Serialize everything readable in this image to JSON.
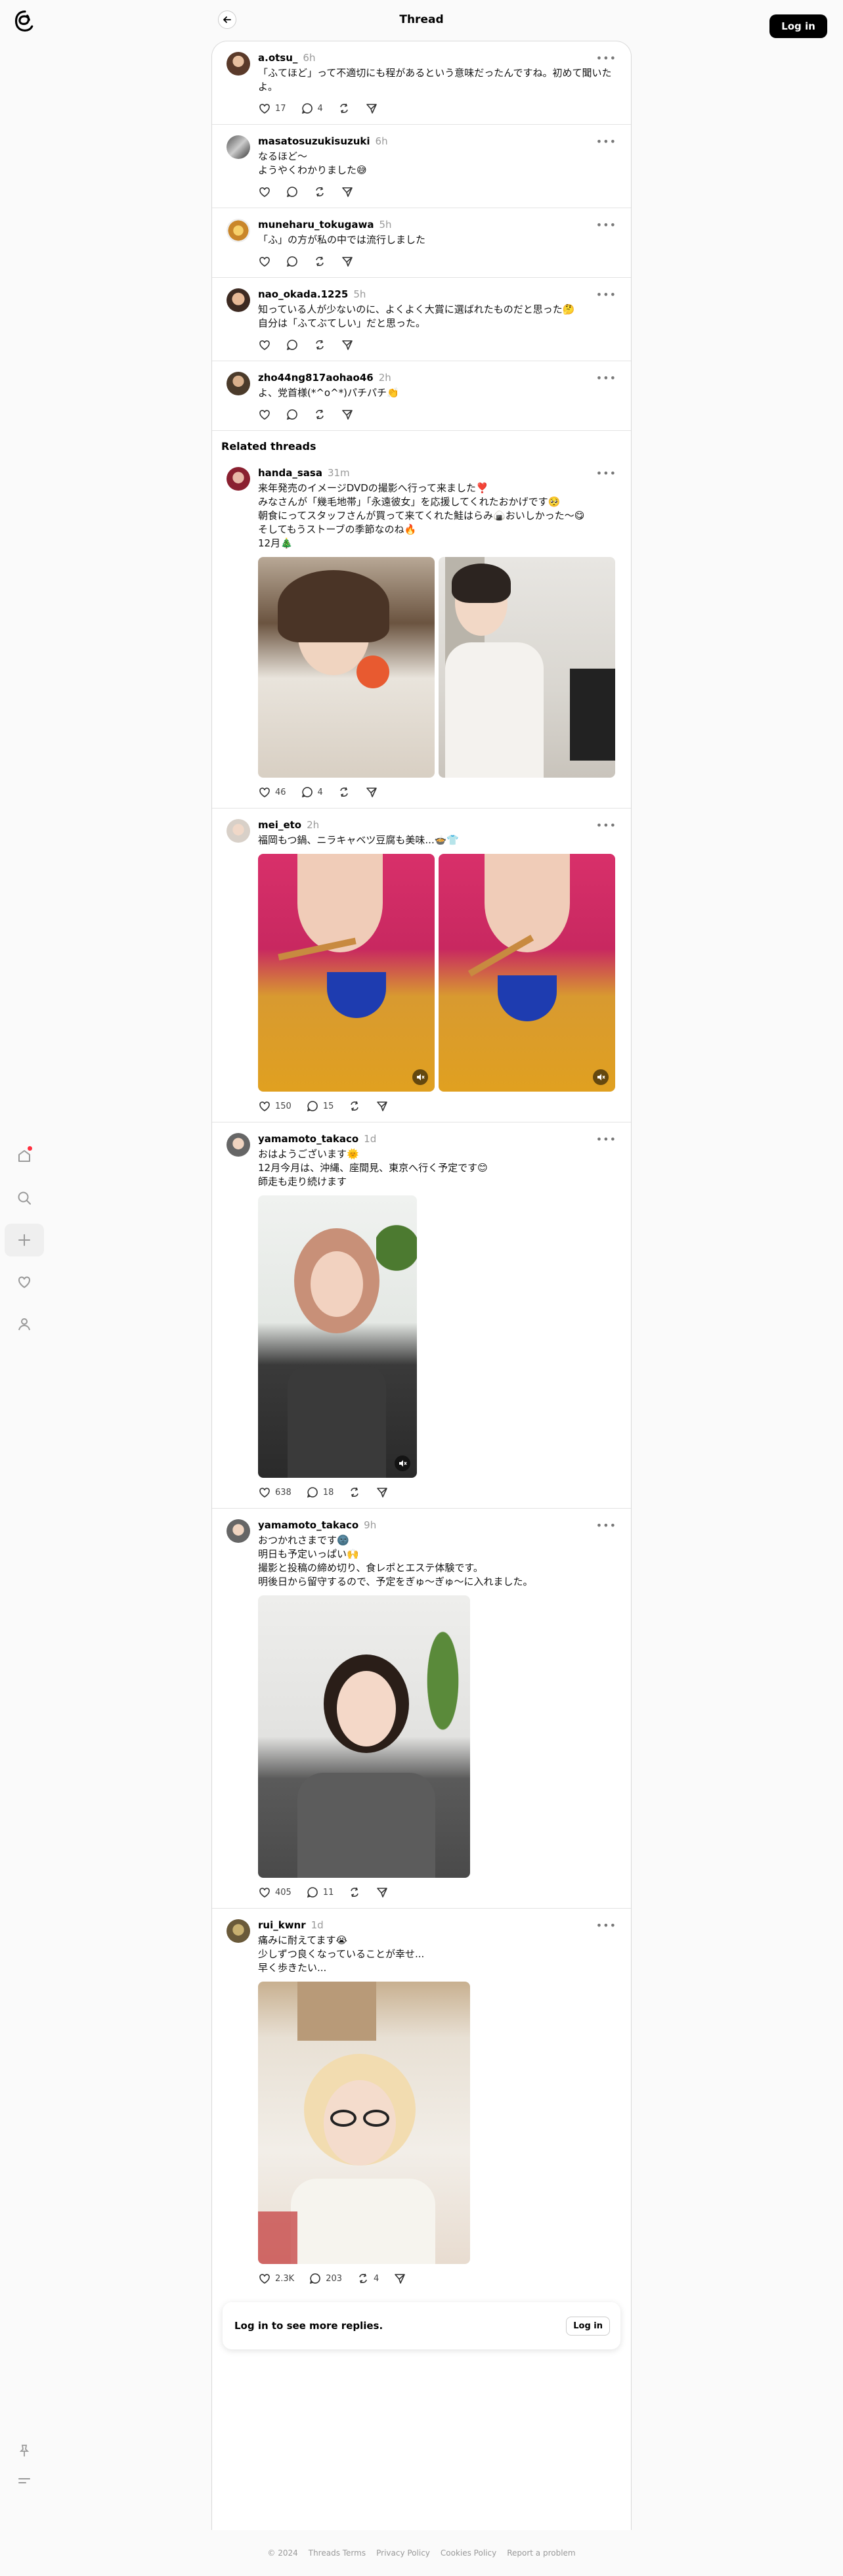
{
  "header": {
    "title": "Thread",
    "login_label": "Log in"
  },
  "root_post": {
    "username": "a.otsu_",
    "time": "6h",
    "text": "「ふてほど」って不適切にも程があるという意味だったんですね。初めて聞いたよ。",
    "likes": "17",
    "replies": "4"
  },
  "replies": [
    {
      "username": "masatosuzukisuzuki",
      "time": "6h",
      "text": "なるほど〜\nようやくわかりました😅"
    },
    {
      "username": "muneharu_tokugawa",
      "time": "5h",
      "text": "「ふ」の方が私の中では流行しました"
    },
    {
      "username": "nao_okada.1225",
      "time": "5h",
      "text": "知っている人が少ないのに、よくよく大賞に選ばれたものだと思った🤔\n自分は「ふてぶてしい」だと思った。"
    },
    {
      "username": "zho44ng817aohao46",
      "time": "2h",
      "text": "よ、党首様(*^o^*)パチパチ👏"
    }
  ],
  "related_title": "Related threads",
  "related": [
    {
      "username": "handa_sasa",
      "time": "31m",
      "text": "来年発売のイメージDVDの撮影へ行って来ました❣️\nみなさんが「幾毛地帯」「永遠彼女」を応援してくれたおかげです🥺\n朝食にってスタッフさんが買って来てくれた鮭はらみ🍙おいしかった〜😋\nそしてもうストーブの季節なのね🔥\n12月🎄",
      "likes": "46",
      "replies": "4",
      "reposts": ""
    },
    {
      "username": "mei_eto",
      "time": "2h",
      "text": "福岡もつ鍋、ニラキャベツ豆腐も美味...🍲👕",
      "likes": "150",
      "replies": "15",
      "reposts": ""
    },
    {
      "username": "yamamoto_takaco",
      "time": "1d",
      "text": "おはようございます🌞\n12月今月は、沖縄、座間見、東京へ行く予定です😊\n師走も走り続けます",
      "likes": "638",
      "replies": "18",
      "reposts": ""
    },
    {
      "username": "yamamoto_takaco",
      "time": "9h",
      "text": "おつかれさまです🌚\n明日も予定いっぱい🙌\n撮影と投稿の締め切り、食レポとエステ体験です。\n明後日から留守するので、予定をぎゅ〜ぎゅ〜に入れました。",
      "likes": "405",
      "replies": "11",
      "reposts": ""
    },
    {
      "username": "rui_kwnr",
      "time": "1d",
      "text": "痛みに耐えてます😭\n少しずつ良くなっていることが幸せ...\n早く歩きたい...",
      "likes": "2.3K",
      "replies": "203",
      "reposts": "4"
    }
  ],
  "login_more": {
    "text": "Log in to see more replies.",
    "button": "Log in"
  },
  "footer": {
    "copyright": "© 2024",
    "links": [
      "Threads Terms",
      "Privacy Policy",
      "Cookies Policy",
      "Report a problem"
    ]
  },
  "icons": {
    "logo": "threads-logo-icon",
    "back": "arrow-left-icon",
    "nav": [
      "home-icon",
      "search-icon",
      "plus-icon",
      "heart-icon",
      "profile-icon"
    ],
    "bottom": [
      "pin-icon",
      "menu-icon"
    ],
    "actions": [
      "heart-icon",
      "comment-icon",
      "repost-icon",
      "share-icon"
    ]
  },
  "colors": {
    "accent": "#000000",
    "notification": "#ff3040",
    "muted": "#999999"
  }
}
